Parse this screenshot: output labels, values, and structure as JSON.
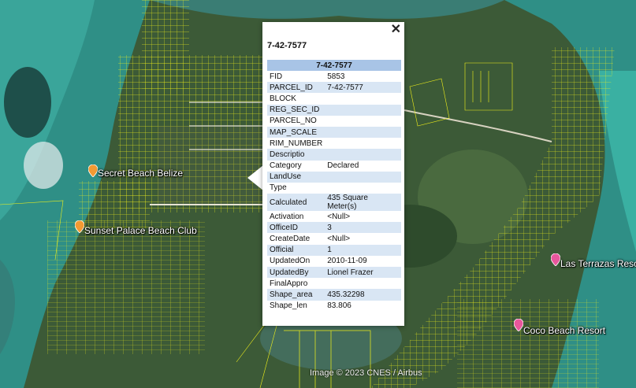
{
  "map": {
    "labels": [
      {
        "id": "secret-beach",
        "text": "Secret Beach Belize",
        "pin_color": "#f39a32"
      },
      {
        "id": "sunset-palace",
        "text": "Sunset Palace Beach Club",
        "pin_color": "#f39a32"
      },
      {
        "id": "las-terrazas",
        "text": "Las Terrazas Reso",
        "pin_color": "#e8579c"
      },
      {
        "id": "coco-beach",
        "text": "Coco Beach Resort",
        "pin_color": "#e8579c"
      }
    ],
    "attribution": "Image © 2023 CNES / Airbus",
    "parcel_line_color": "#f2f21a"
  },
  "popup": {
    "title": "7-42-7577",
    "close": "✕",
    "table_header": "7-42-7577",
    "rows": [
      {
        "key": "FID",
        "value": "5853"
      },
      {
        "key": "PARCEL_ID",
        "value": "7-42-7577"
      },
      {
        "key": "BLOCK",
        "value": ""
      },
      {
        "key": "REG_SEC_ID",
        "value": ""
      },
      {
        "key": "PARCEL_NO",
        "value": ""
      },
      {
        "key": "MAP_SCALE",
        "value": ""
      },
      {
        "key": "RIM_NUMBER",
        "value": ""
      },
      {
        "key": "Descriptio",
        "value": ""
      },
      {
        "key": "Category",
        "value": "Declared"
      },
      {
        "key": "LandUse",
        "value": ""
      },
      {
        "key": "Type",
        "value": ""
      },
      {
        "key": "Calculated",
        "value": "435 Square Meter(s)"
      },
      {
        "key": "Activation",
        "value": "<Null>"
      },
      {
        "key": "OfficeID",
        "value": "3"
      },
      {
        "key": "CreateDate",
        "value": "<Null>"
      },
      {
        "key": "Official",
        "value": "1"
      },
      {
        "key": "UpdatedOn",
        "value": "2010-11-09"
      },
      {
        "key": "UpdatedBy",
        "value": "Lionel Frazer"
      },
      {
        "key": "FinalAppro",
        "value": ""
      },
      {
        "key": "Shape_area",
        "value": "435.32298"
      },
      {
        "key": "Shape_len",
        "value": "83.806"
      }
    ]
  }
}
